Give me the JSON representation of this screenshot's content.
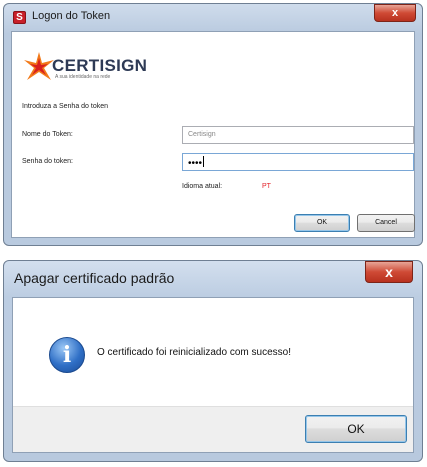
{
  "logon_dialog": {
    "title": "Logon do Token",
    "app_icon": "S",
    "close_label": "x",
    "logo": {
      "name": "CERTISIGN",
      "tagline": "A sua identidade na rede",
      "icon": "certisign-star-icon",
      "colors": {
        "star": "#f27a1a",
        "text": "#2e3a55"
      }
    },
    "intro": "Introduza a Senha do token",
    "token_name_label": "Nome do Token:",
    "token_name_value": "Certisign",
    "password_label": "Senha do token:",
    "password_value": "••••",
    "language_label": "Idioma atual:",
    "language_value": "PT",
    "ok_label": "OK",
    "cancel_label": "Cancel"
  },
  "message_dialog": {
    "title": "Apagar certificado padrão",
    "close_label": "x",
    "icon": "info-icon",
    "icon_glyph": "i",
    "message": "O certificado foi reinicializado com sucesso!",
    "ok_label": "OK"
  },
  "colors": {
    "accent_red": "#e3242b",
    "title_bar": "#b9cadf",
    "close_button": "#cf4a35"
  }
}
